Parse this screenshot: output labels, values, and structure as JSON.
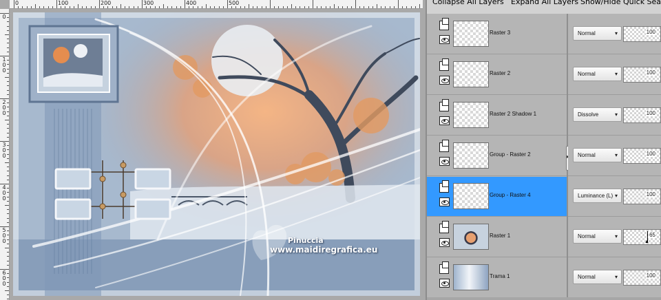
{
  "layers_toolbar": {
    "collapse_all": "Collapse All Layers",
    "expand_all": "Expand All Layers",
    "quick_search": "Show/Hide Quick Searc"
  },
  "ruler": {
    "horizontal_labels": [
      "0",
      "100",
      "200",
      "300",
      "400",
      "500"
    ],
    "vertical_labels": [
      "0",
      "1\n0\n0",
      "2\n0\n0",
      "3\n0\n0",
      "4\n0\n0",
      "5\n0\n0",
      "6\n0\n0"
    ]
  },
  "watermark": {
    "name": "Pinuccia",
    "site": "www.maidiregrafica.eu"
  },
  "layers": [
    {
      "name": "Raster 3",
      "blend": "Normal",
      "opacity": "100",
      "thumb": "transparent",
      "selected": false
    },
    {
      "name": "Raster 2",
      "blend": "Normal",
      "opacity": "100",
      "thumb": "transparent",
      "selected": false
    },
    {
      "name": "Raster 2 Shadow 1",
      "blend": "Dissolve",
      "opacity": "100",
      "thumb": "transparent",
      "selected": false
    },
    {
      "name": "Group - Raster 2",
      "blend": "Normal",
      "opacity": "100",
      "thumb": "transparent",
      "selected": false
    },
    {
      "name": "Group - Raster 4",
      "blend": "Luminance (L)",
      "opacity": "100",
      "thumb": "transparent",
      "selected": true
    },
    {
      "name": "Raster 1",
      "blend": "Normal",
      "opacity": "65",
      "thumb": "image",
      "selected": false
    },
    {
      "name": "Trama 1",
      "blend": "Normal",
      "opacity": "100",
      "thumb": "image",
      "selected": false
    }
  ],
  "colors": {
    "selected_layer": "#3399ff",
    "panel_bg": "#b5b5b5"
  },
  "icons": {
    "layer_type": "layer-group-icon",
    "visibility": "eye-icon",
    "dropdown": "chevron-down-icon"
  }
}
